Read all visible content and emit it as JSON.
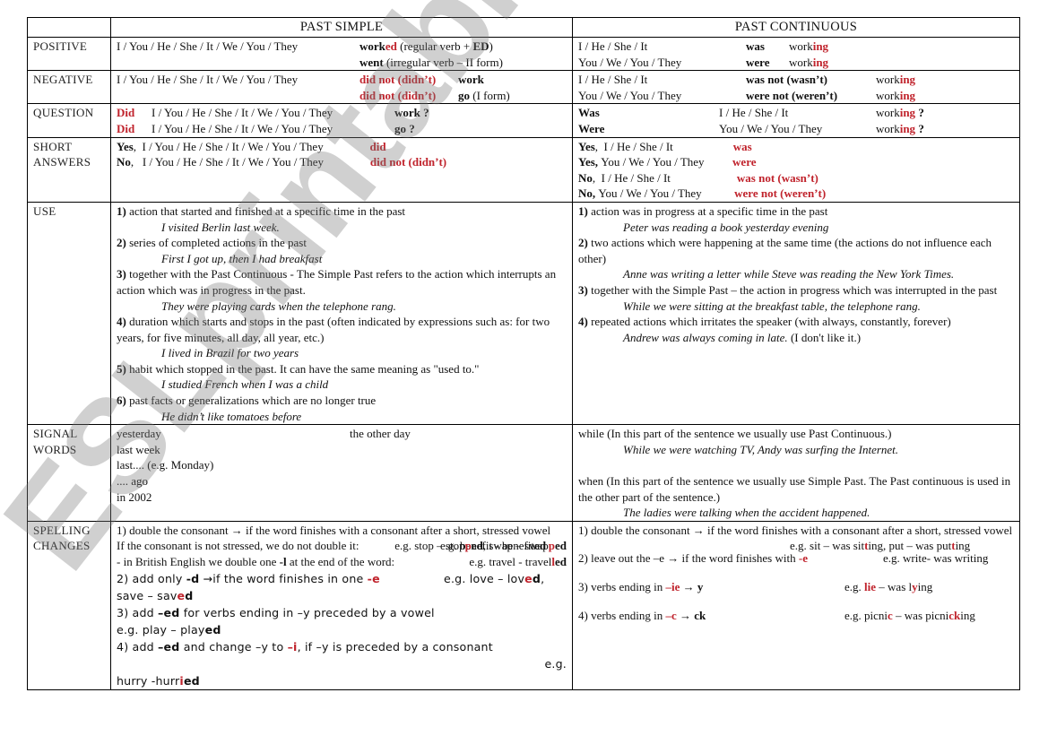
{
  "headers": {
    "past_simple": "PAST SIMPLE",
    "past_continuous": "PAST CONTINUOUS"
  },
  "labels": {
    "positive": "POSITIVE",
    "negative": "NEGATIVE",
    "question": "QUESTION",
    "short_answers_1": "SHORT",
    "short_answers_2": "ANSWERS",
    "use": "USE",
    "signal_1": "SIGNAL",
    "signal_2": "WORDS",
    "spelling_1": "SPELLING",
    "spelling_2": "CHANGES"
  },
  "pronouns": {
    "all": "I / You / He / She / It / We / You / They",
    "singular": "I  / He / She / It",
    "plural": "You / We / You / They"
  },
  "positive": {
    "simple": {
      "worked_stem": "work",
      "worked_suffix": "ed",
      "worked_note_a": " (regular verb + ",
      "worked_note_b": "ED",
      "worked_note_c": ")",
      "went": "went",
      "went_note": " (irregular verb – II form)"
    },
    "continuous": {
      "was": "was",
      "were": "were",
      "ing_stem": "work",
      "ing_suffix": "ing"
    }
  },
  "negative": {
    "simple": {
      "didnt": "did not (didn’t)",
      "work": "work",
      "go": "go",
      "go_note": " (I form)"
    },
    "continuous": {
      "wasnt": "was not (wasn’t)",
      "werent": "were not (weren’t)"
    }
  },
  "question": {
    "simple": {
      "did": "Did",
      "work": "work ?",
      "go": "go ?"
    },
    "continuous": {
      "was": "Was",
      "were": "Were",
      "q": " ?"
    }
  },
  "short_answers": {
    "simple": {
      "yes": "Yes",
      "no": "No",
      "did": "did",
      "didnt": "did not (didn’t)"
    },
    "continuous": {
      "yes": "Yes",
      "no": "No",
      "was": "was",
      "were": "were",
      "wasnt": "was not (wasn’t)",
      "werent": "were not (weren’t)"
    }
  },
  "use": {
    "simple": [
      {
        "num": "1)",
        "text": " action that started and finished at a specific time in the past",
        "example": "I visited Berlin last week."
      },
      {
        "num": "2)",
        "text": " series of completed actions in the past",
        "example": "First I got up, then I had breakfast"
      },
      {
        "num": "3)",
        "text": " together with the Past Continuous - The Simple Past refers to the action which interrupts an action which was in progress in the past.",
        "example": "They were playing cards when the telephone rang."
      },
      {
        "num": "4)",
        "text": " duration which starts and stops in the past (often indicated by expressions such as: for two years, for five minutes, all day, all year, etc.)",
        "example": "I lived in Brazil for two years"
      },
      {
        "num": "5)",
        "text": " habit which stopped in the past. It can have the same meaning as \"used to.\"",
        "example": "I studied French when I was a child"
      },
      {
        "num": "6)",
        "text": " past facts or generalizations which are no longer true",
        "example": "He didn’t like tomatoes before"
      }
    ],
    "continuous": [
      {
        "num": "1)",
        "text": " action was in progress at a specific time in the past",
        "example": "Peter was reading a book yesterday evening",
        "after": ""
      },
      {
        "num": "2)",
        "text": " two actions which were happening at the same time (the actions do not influence each other)",
        "example": "Anne was writing a letter while Steve was reading the New York Times.",
        "after": ""
      },
      {
        "num": "3)",
        "text": " together with the Simple Past – the action in progress which was interrupted in the past",
        "example": "While we were sitting at the breakfast table, the telephone rang.",
        "after": ""
      },
      {
        "num": "4)",
        "text": " repeated actions which irritates the speaker (with always, constantly, forever)",
        "example": "Andrew was always coming in late.",
        "after": " (I don't like it.)"
      }
    ]
  },
  "signal": {
    "simple": {
      "left": [
        "yesterday",
        "last week",
        "last.... (e.g. Monday)",
        ".... ago",
        "in 2002"
      ],
      "right": "the other day"
    },
    "continuous": {
      "while": "while  (In this part of the sentence we usually use Past Continuous.)",
      "while_example": "While we were watching TV, Andy was surfing the Internet.",
      "when": "when  (In this part of the sentence we usually use Simple Past. The Past continuous is used in the other part of the sentence.)",
      "when_example": "The ladies were talking when the accident happened."
    }
  },
  "spelling": {
    "simple": {
      "r1_text": "1) double the consonant  → if the word finishes with a consonant after a short, stressed vowel",
      "r1_eg": "e.g. stop – stop",
      "r1_p1": "p",
      "r1_ed1": "ed",
      "r1_mid": ", swap – swap",
      "r1_p2": "p",
      "r1_ed2": "ed",
      "r1b_text": "If the consonant is not stressed, we do not double it:",
      "r1b_eg": "e.g. benefit - benefit",
      "r1b_ed": "ed",
      "r1c_text_a": "- in British English we double one ",
      "r1c_l": "-l",
      "r1c_text_b": " at the end of the word:",
      "r1c_eg": "e.g. travel - travel",
      "r1c_l2": "l",
      "r1c_ed": "ed",
      "r2_a": "2) add only ",
      "r2_d": "-d",
      "r2_b": " →if the word finishes in one ",
      "r2_e": "-e",
      "r2_eg": "e.g. love – lov",
      "r2_e2": "e",
      "r2_d2": "d",
      "r2_c": ",",
      "r2_line2": "save – sav",
      "r2_e3": "e",
      "r2_d3": "d",
      "r3_a": "3) add ",
      "r3_ed": "–ed",
      "r3_b": " for verbs ending in –y preceded by a vowel",
      "r3_eg": "e.g. play – play",
      "r3_ed2": "ed",
      "r4_a": "4) add ",
      "r4_ed": "–ed",
      "r4_b": " and change –y to ",
      "r4_i": "–i",
      "r4_c": ", if –y is preceded by a consonant",
      "r4_eg": "e.g.",
      "r4_line3": "hurry -hurr",
      "r4_i2": "i",
      "r4_ed2": "ed"
    },
    "continuous": {
      "r1_text": "1) double the consonant → if the word finishes with a consonant after a short, stressed vowel",
      "r1_eg_a": "e.g. sit – was sit",
      "r1_t1": "t",
      "r1_eg_b": "ing, put – was put",
      "r1_t2": "t",
      "r1_eg_c": "ing",
      "r2_a": "2) leave out the –e → if the word finishes with ",
      "r2_e": "-e",
      "r2_eg": "e.g. write- was writing",
      "r3_a": "3) verbs ending in ",
      "r3_ie": "–ie",
      "r3_arrow": " → ",
      "r3_y": "y",
      "r3_eg_a": "e.g. ",
      "r3_lie": "lie",
      "r3_eg_b": " – was l",
      "r3_y2": "y",
      "r3_eg_c": "ing",
      "r4_a": "4) verbs ending in ",
      "r4_c": "–c",
      "r4_arrow": " → ",
      "r4_ck": "ck",
      "r4_eg_a": "e.g. picni",
      "r4_c2": "c",
      "r4_eg_b": " – was picni",
      "r4_ck2": "ck",
      "r4_eg_c": "ing"
    }
  },
  "watermark": "ESLprintables.com",
  "colors": {
    "accent_red": "#c0232c",
    "border": "#000000",
    "watermark": "#999999"
  }
}
